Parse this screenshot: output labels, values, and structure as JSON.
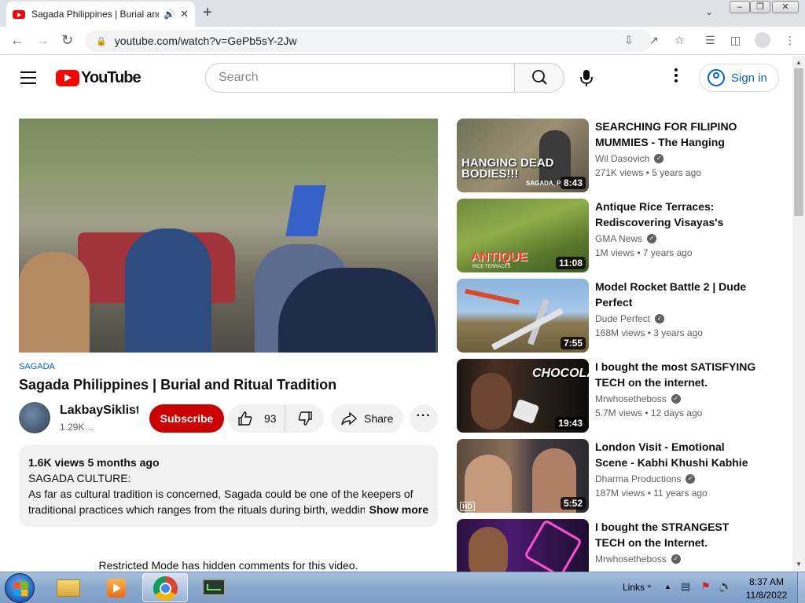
{
  "browser": {
    "tab_title": "Sagada Philippines | Burial and Ritual Tradition - YouTube",
    "url": "youtube.com/watch?v=GePb5sY-2Jw"
  },
  "header": {
    "logo_text": "YouTube",
    "search_placeholder": "Search",
    "signin_label": "Sign in"
  },
  "video": {
    "hashtag": "SAGADA",
    "title": "Sagada Philippines | Burial and Ritual Tradition",
    "channel_name": "LakbaySiklista",
    "subscribers": "1.29K…",
    "subscribe_label": "Subscribe",
    "likes": "93",
    "share_label": "Share"
  },
  "description": {
    "meta": "1.6K views  5 months ago",
    "line1": "SAGADA CULTURE:",
    "line2": "As far as cultural tradition is concerned, Sagada could be one of the keepers of",
    "line3": "traditional practices which ranges from the rituals during birth, wedding and death.",
    "show_more": "Show more"
  },
  "comments_notice": "Restricted Mode has hidden comments for this video.",
  "recommendations": [
    {
      "title": "SEARCHING FOR FILIPINO MUMMIES - The Hanging Coffins of Sagada",
      "channel": "Wil Dasovich",
      "views": "271K views",
      "age": "5 years ago",
      "duration": "8:43",
      "thumb_text": "HANGING DEAD BODIES!!!",
      "thumb_sub": "SAGADA, PHI..."
    },
    {
      "title": "Antique Rice Terraces: Rediscovering Visayas's hidden rice terraces",
      "channel": "GMA News",
      "views": "1M views",
      "age": "7 years ago",
      "duration": "11:08",
      "thumb_text": "ANTIQUE",
      "thumb_sub": "RICE TERRACES"
    },
    {
      "title": "Model Rocket Battle 2 | Dude Perfect",
      "channel": "Dude Perfect",
      "views": "168M views",
      "age": "3 years ago",
      "duration": "7:55"
    },
    {
      "title": "I bought the most SATISFYING TECH on the internet.",
      "channel": "Mrwhosetheboss",
      "views": "5.7M views",
      "age": "12 days ago",
      "duration": "19:43",
      "thumb_text": "CHOCOLATE"
    },
    {
      "title": "London Visit - Emotional Scene - Kabhi Khushi Kabhie Gham - Shah Rukh Khan",
      "channel": "Dharma Productions",
      "views": "187M views",
      "age": "11 years ago",
      "duration": "5:52",
      "thumb_text": "HD"
    },
    {
      "title": "I bought the STRANGEST TECH on the Internet.",
      "channel": "Mrwhosetheboss",
      "views": "",
      "age": "",
      "duration": ""
    }
  ],
  "taskbar": {
    "links_label": "Links",
    "time": "8:37 AM",
    "date": "11/8/2022"
  }
}
